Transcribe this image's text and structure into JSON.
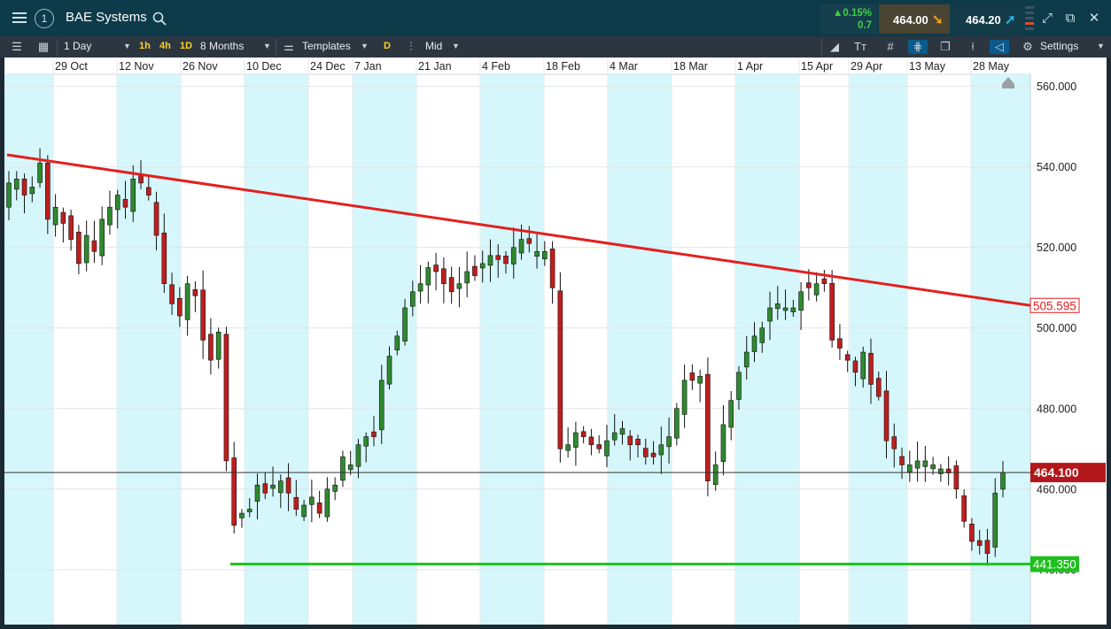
{
  "header": {
    "instrument": "BAE Systems",
    "change_pct": "▲0.15%",
    "change_abs": "0.7",
    "sell_price": "464.00",
    "buy_price": "464.20"
  },
  "toolbar": {
    "interval": "1 Day",
    "quick_intervals": [
      "1h",
      "4h",
      "1D"
    ],
    "range": "8 Months",
    "templates_label": "Templates",
    "d_label": "D",
    "price_type": "Mid",
    "settings_label": "Settings"
  },
  "colors": {
    "background": "#ffffff",
    "week_band": "#d5f7fb",
    "up_candle": "#2f8a2f",
    "down_candle": "#c01e1e",
    "resistance_line": "#e32020",
    "support_line": "#1ec01e",
    "current_price_tag": "#b3171b"
  },
  "chart_data": {
    "type": "candlestick",
    "instrument": "BAE Systems",
    "date_labels": [
      "29 Oct",
      "12 Nov",
      "26 Nov",
      "10 Dec",
      "24 Dec",
      "7 Jan",
      "21 Jan",
      "4 Feb",
      "18 Feb",
      "4 Mar",
      "18 Mar",
      "1 Apr",
      "15 Apr",
      "29 Apr",
      "13 May",
      "28 May"
    ],
    "y_ticks": [
      "560.000",
      "540.000",
      "520.000",
      "500.000",
      "480.000",
      "460.000",
      "440.000"
    ],
    "ylim": [
      427,
      563
    ],
    "grid": true,
    "current_price": {
      "value": 464.1,
      "label": "464.100"
    },
    "annotations": [
      {
        "type": "trendline",
        "color": "red",
        "start": 543,
        "end": 505.595,
        "label": "505.595"
      },
      {
        "type": "horizontal",
        "color": "green",
        "value": 441.35,
        "label": "441.350"
      }
    ],
    "close": [
      536,
      537,
      533,
      535,
      541,
      527,
      530,
      526,
      522,
      516,
      523,
      519,
      527,
      530,
      533,
      530,
      537,
      536,
      533,
      523,
      511,
      506,
      503,
      511,
      508,
      497,
      492,
      499,
      467,
      451,
      454,
      455,
      461,
      459,
      461,
      462,
      459,
      455,
      456,
      458,
      454,
      460,
      461,
      468,
      466,
      471,
      473,
      473,
      487,
      493,
      498,
      505,
      509,
      511,
      515,
      514,
      511,
      509,
      511,
      514,
      513,
      516,
      518,
      517,
      516,
      520,
      522,
      521,
      519,
      519,
      510,
      470,
      471,
      474,
      473,
      471,
      470,
      472,
      474,
      475,
      471,
      471,
      468,
      468,
      471,
      473,
      480,
      487,
      487,
      488,
      462,
      466,
      476,
      482,
      489,
      494,
      498,
      500,
      505,
      506,
      505,
      505,
      509,
      510,
      511,
      511,
      497,
      495,
      492,
      489,
      494,
      486,
      483,
      472,
      470,
      466,
      466,
      467,
      467,
      466,
      465,
      464,
      460,
      452,
      447,
      446,
      444,
      459,
      464.1
    ],
    "candle_count": 129,
    "note": "Daily candles; open values follow the prior close with gaps as depicted."
  }
}
